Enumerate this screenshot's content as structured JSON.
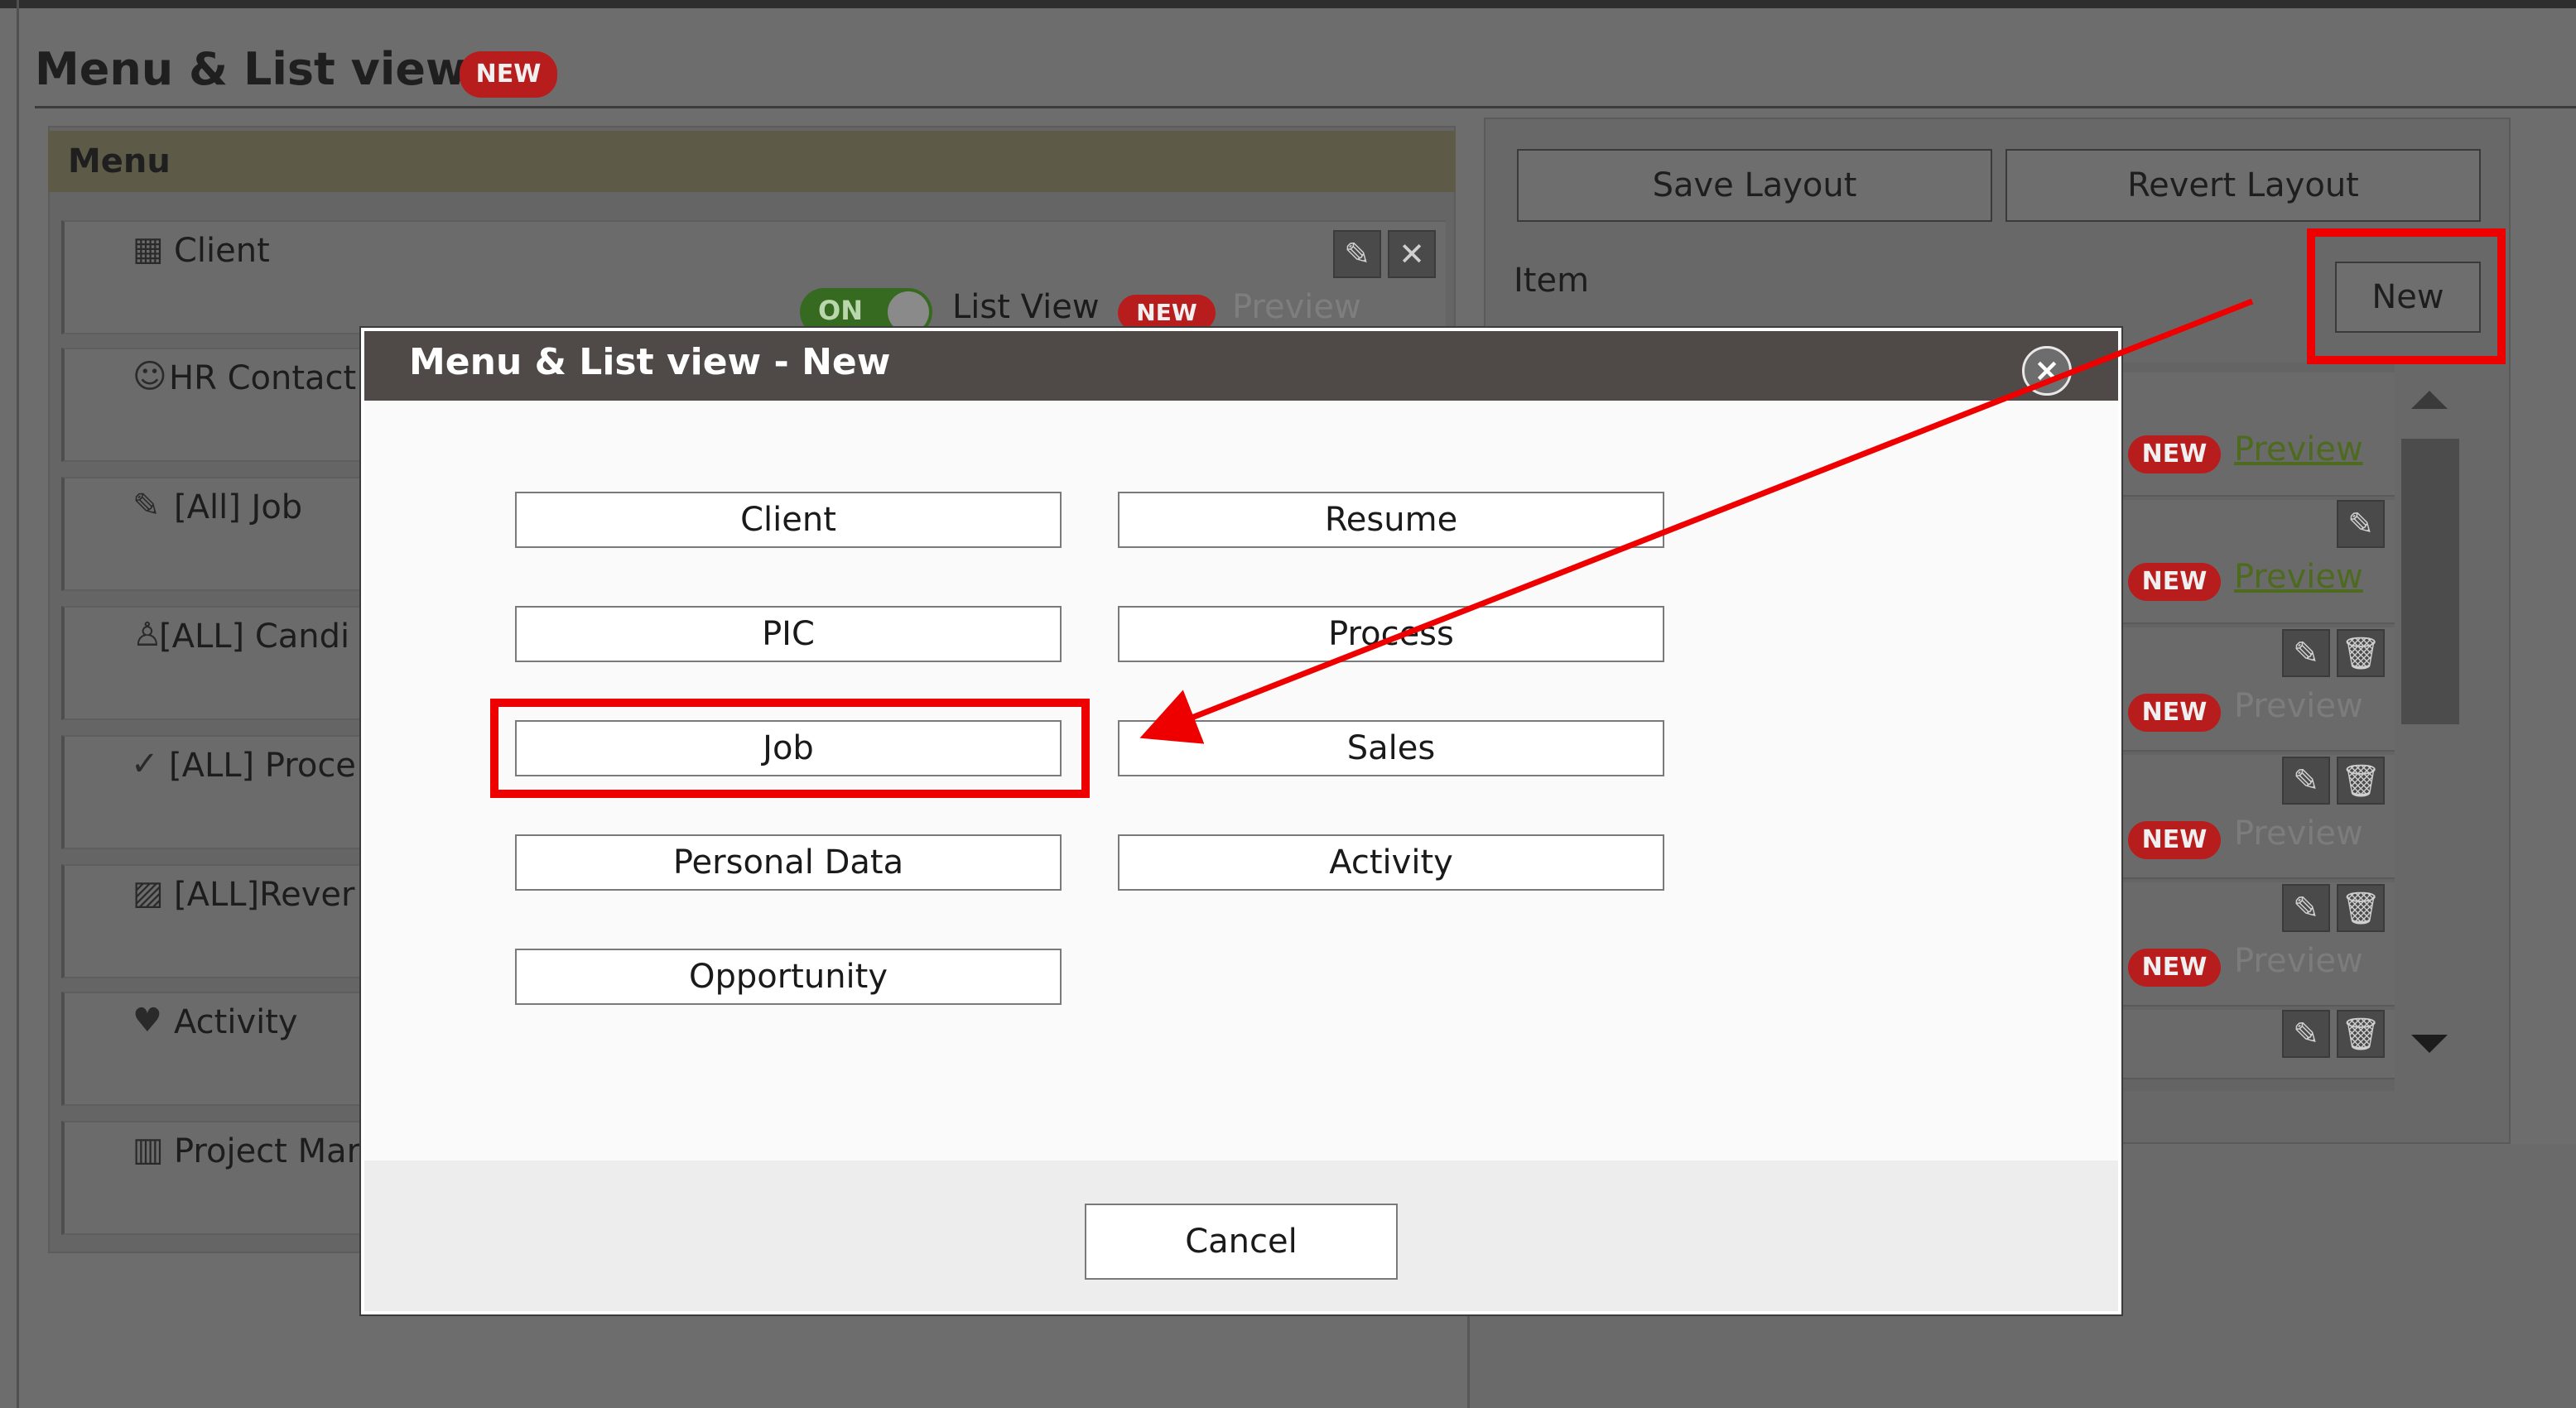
{
  "page": {
    "title": "Menu & List view",
    "title_badge": "NEW"
  },
  "menu": {
    "header": "Menu",
    "items": [
      {
        "icon": "building-icon",
        "glyph": "▦",
        "label": "Client"
      },
      {
        "icon": "person-icon",
        "glyph": "☺",
        "label": "HR Contact"
      },
      {
        "icon": "note-icon",
        "glyph": "✎",
        "label": "[All] Job"
      },
      {
        "icon": "candidate-icon",
        "glyph": "♙",
        "label": "[ALL] Candi"
      },
      {
        "icon": "check-icon",
        "glyph": "✓",
        "label": "[ALL] Proce"
      },
      {
        "icon": "chart-icon",
        "glyph": "▨",
        "label": "[ALL]Rever"
      },
      {
        "icon": "handshake-icon",
        "glyph": "♥",
        "label": "Activity"
      },
      {
        "icon": "bar-chart-icon",
        "glyph": "▥",
        "label": "Project Mar"
      }
    ],
    "client_row": {
      "edit_glyph": "✎",
      "close_glyph": "✕",
      "toggle_text": "ON",
      "list_view_label": "List View",
      "badge": "NEW",
      "preview": "Preview"
    }
  },
  "right_panel": {
    "save_layout": "Save Layout",
    "revert_layout": "Revert Layout",
    "item_label": "Item",
    "new_button": "New",
    "rows": [
      {
        "badge": "NEW",
        "preview": "Preview",
        "active": true
      },
      {
        "badge": "NEW",
        "preview": "Preview",
        "active": true
      },
      {
        "badge": "NEW",
        "preview": "Preview",
        "active": false
      },
      {
        "badge": "NEW",
        "preview": "Preview",
        "active": false
      },
      {
        "badge": "NEW",
        "preview": "Preview",
        "active": false
      }
    ],
    "edit_glyph": "✎",
    "trash_glyph": "🗑"
  },
  "modal": {
    "title": "Menu & List view - New",
    "close_glyph": "×",
    "options": [
      "Client",
      "Resume",
      "PIC",
      "Process",
      "Job",
      "Sales",
      "Personal Data",
      "Activity",
      "Opportunity"
    ],
    "cancel": "Cancel"
  },
  "colors": {
    "highlight": "#ee0000",
    "badge": "#b81d1d",
    "modal_header": "#4f4a47"
  }
}
